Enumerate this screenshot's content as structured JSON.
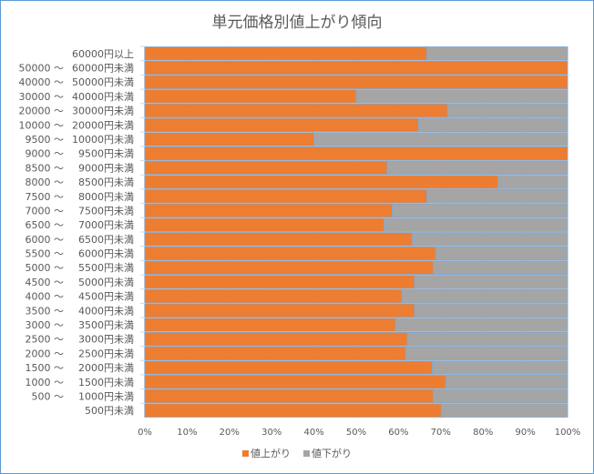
{
  "chart_data": {
    "type": "bar",
    "orientation": "horizontal",
    "stacked": "percent",
    "title": "単元価格別値上がり傾向",
    "xlabel": "",
    "ylabel": "",
    "xlim": [
      0,
      100
    ],
    "x_ticks": [
      "0%",
      "10%",
      "20%",
      "30%",
      "40%",
      "50%",
      "60%",
      "70%",
      "80%",
      "90%",
      "100%"
    ],
    "grid": true,
    "legend_position": "bottom",
    "categories": [
      {
        "from": "",
        "to": "60000円以上"
      },
      {
        "from": "50000 ～",
        "to": "60000円未満"
      },
      {
        "from": "40000 ～",
        "to": "50000円未満"
      },
      {
        "from": "30000 ～",
        "to": "40000円未満"
      },
      {
        "from": "20000 ～",
        "to": "30000円未満"
      },
      {
        "from": "10000 ～",
        "to": "20000円未満"
      },
      {
        "from": "9500 ～",
        "to": "10000円未満"
      },
      {
        "from": "9000 ～",
        "to": "9500円未満"
      },
      {
        "from": "8500 ～",
        "to": "9000円未満"
      },
      {
        "from": "8000 ～",
        "to": "8500円未満"
      },
      {
        "from": "7500 ～",
        "to": "8000円未満"
      },
      {
        "from": "7000 ～",
        "to": "7500円未満"
      },
      {
        "from": "6500 ～",
        "to": "7000円未満"
      },
      {
        "from": "6000 ～",
        "to": "6500円未満"
      },
      {
        "from": "5500 ～",
        "to": "6000円未満"
      },
      {
        "from": "5000 ～",
        "to": "5500円未満"
      },
      {
        "from": "4500 ～",
        "to": "5000円未満"
      },
      {
        "from": "4000 ～",
        "to": "4500円未満"
      },
      {
        "from": "3500 ～",
        "to": "4000円未満"
      },
      {
        "from": "3000 ～",
        "to": "3500円未満"
      },
      {
        "from": "2500 ～",
        "to": "3000円未満"
      },
      {
        "from": "2000 ～",
        "to": "2500円未満"
      },
      {
        "from": "1500 ～",
        "to": "2000円未満"
      },
      {
        "from": "1000 ～",
        "to": "1500円未満"
      },
      {
        "from": "500 ～",
        "to": "1000円未満"
      },
      {
        "from": "",
        "to": "500円未満"
      }
    ],
    "series": [
      {
        "name": "値上がり",
        "color": "#ed7d31",
        "values": [
          66.7,
          100,
          100,
          50,
          71.6,
          64.7,
          40,
          100,
          57.3,
          83.5,
          66.7,
          58.5,
          56.6,
          63.2,
          68.8,
          68.2,
          63.8,
          60.8,
          63.8,
          59.3,
          62.1,
          61.7,
          68.0,
          71.2,
          68.2,
          70.1
        ]
      },
      {
        "name": "値下がり",
        "color": "#a5a5a5",
        "values": [
          33.3,
          0,
          0,
          50,
          28.4,
          35.3,
          60,
          0,
          42.7,
          16.5,
          33.3,
          41.5,
          43.4,
          36.8,
          31.2,
          31.8,
          36.2,
          39.2,
          36.2,
          40.7,
          37.9,
          38.3,
          32.0,
          28.8,
          31.8,
          29.9
        ]
      }
    ]
  }
}
